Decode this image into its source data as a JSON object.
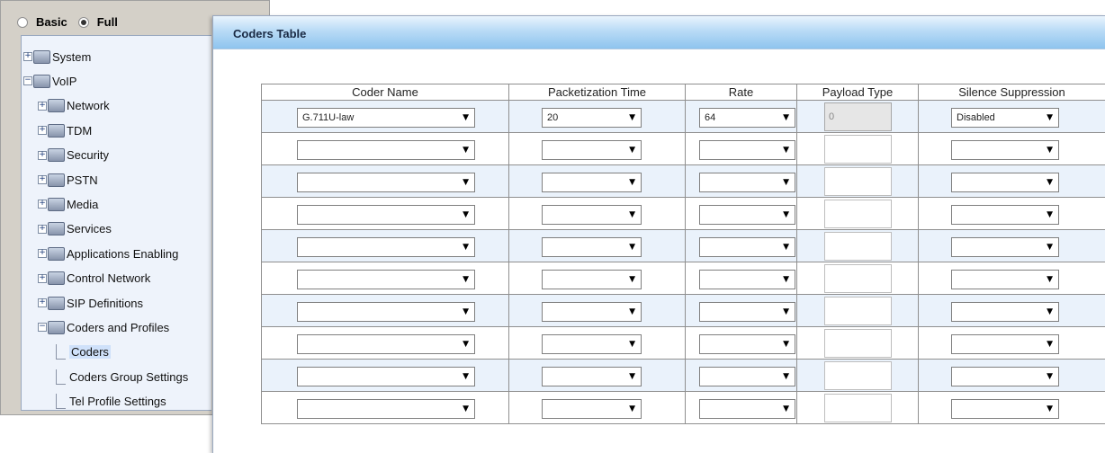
{
  "mode": {
    "basic_label": "Basic",
    "full_label": "Full",
    "selected": "Full"
  },
  "tree": [
    {
      "label": "System",
      "type": "folder",
      "toggle": "+",
      "selected": false
    },
    {
      "label": "VoIP",
      "type": "folder",
      "toggle": "−",
      "selected": false
    },
    {
      "label": "Network",
      "type": "folder",
      "toggle": "+",
      "selected": false
    },
    {
      "label": "TDM",
      "type": "folder",
      "toggle": "+",
      "selected": false
    },
    {
      "label": "Security",
      "type": "folder",
      "toggle": "+",
      "selected": false
    },
    {
      "label": "PSTN",
      "type": "folder",
      "toggle": "+",
      "selected": false
    },
    {
      "label": "Media",
      "type": "folder",
      "toggle": "+",
      "selected": false
    },
    {
      "label": "Services",
      "type": "folder",
      "toggle": "+",
      "selected": false
    },
    {
      "label": "Applications Enabling",
      "type": "folder",
      "toggle": "+",
      "selected": false
    },
    {
      "label": "Control Network",
      "type": "folder",
      "toggle": "+",
      "selected": false
    },
    {
      "label": "SIP Definitions",
      "type": "folder",
      "toggle": "+",
      "selected": false
    },
    {
      "label": "Coders and Profiles",
      "type": "folder",
      "toggle": "−",
      "selected": false
    },
    {
      "label": "Coders",
      "type": "page",
      "toggle": "",
      "selected": true
    },
    {
      "label": "Coders Group Settings",
      "type": "page",
      "toggle": "",
      "selected": false
    },
    {
      "label": "Tel Profile Settings",
      "type": "page",
      "toggle": "",
      "selected": false
    }
  ],
  "content": {
    "title": "Coders Table"
  },
  "table": {
    "columns": [
      "Coder Name",
      "Packetization Time",
      "Rate",
      "Payload Type",
      "Silence Suppression"
    ],
    "rows": [
      {
        "coder": "G.711U-law",
        "ptime": "20",
        "rate": "64",
        "payload": "0",
        "payload_disabled": true,
        "silence": "Disabled"
      },
      {
        "coder": "",
        "ptime": "",
        "rate": "",
        "payload": "",
        "payload_disabled": false,
        "silence": ""
      },
      {
        "coder": "",
        "ptime": "",
        "rate": "",
        "payload": "",
        "payload_disabled": false,
        "silence": ""
      },
      {
        "coder": "",
        "ptime": "",
        "rate": "",
        "payload": "",
        "payload_disabled": false,
        "silence": ""
      },
      {
        "coder": "",
        "ptime": "",
        "rate": "",
        "payload": "",
        "payload_disabled": false,
        "silence": ""
      },
      {
        "coder": "",
        "ptime": "",
        "rate": "",
        "payload": "",
        "payload_disabled": false,
        "silence": ""
      },
      {
        "coder": "",
        "ptime": "",
        "rate": "",
        "payload": "",
        "payload_disabled": false,
        "silence": ""
      },
      {
        "coder": "",
        "ptime": "",
        "rate": "",
        "payload": "",
        "payload_disabled": false,
        "silence": ""
      },
      {
        "coder": "",
        "ptime": "",
        "rate": "",
        "payload": "",
        "payload_disabled": false,
        "silence": ""
      },
      {
        "coder": "",
        "ptime": "",
        "rate": "",
        "payload": "",
        "payload_disabled": false,
        "silence": ""
      }
    ]
  },
  "colors": {
    "header_gradient_end": "#8ec4ee",
    "alt_row": "#eaf2fb",
    "tree_bg": "#eef3fb"
  }
}
